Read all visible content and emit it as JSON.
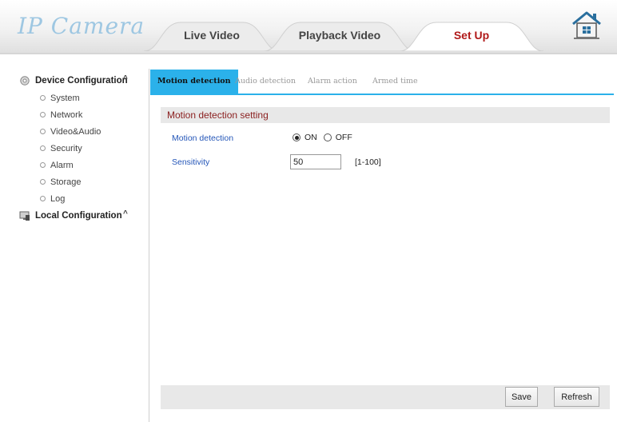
{
  "logo": {
    "text": "IP Camera"
  },
  "tabs": [
    {
      "label": "Live Video",
      "active": false
    },
    {
      "label": "Playback Video",
      "active": false
    },
    {
      "label": "Set Up",
      "active": true
    }
  ],
  "icons": {
    "home": "home-icon",
    "device_config": "gear-icon",
    "local_config": "monitor-icon"
  },
  "sidebar": {
    "groups": [
      {
        "label": "Device Configuration",
        "caret": "^",
        "items": [
          "System",
          "Network",
          "Video&Audio",
          "Security",
          "Alarm",
          "Storage",
          "Log"
        ]
      },
      {
        "label": "Local Configuration",
        "caret": "^",
        "items": []
      }
    ]
  },
  "subtabs": [
    {
      "label": "Motion detection",
      "active": true
    },
    {
      "label": "Audio detection",
      "active": false
    },
    {
      "label": "Alarm action",
      "active": false
    },
    {
      "label": "Armed time",
      "active": false
    }
  ],
  "content": {
    "section_title": "Motion detection setting",
    "motion_label": "Motion detection",
    "on_label": "ON",
    "off_label": "OFF",
    "selected": "ON",
    "sensitivity_label": "Sensitivity",
    "sensitivity_value": "50",
    "sensitivity_range": "[1-100]"
  },
  "buttons": {
    "save": "Save",
    "refresh": "Refresh"
  },
  "colors": {
    "accent": "#2bb1ea",
    "active_tab_text": "#b01818",
    "section_title": "#8a1e1e",
    "field_label": "#2456b8"
  }
}
